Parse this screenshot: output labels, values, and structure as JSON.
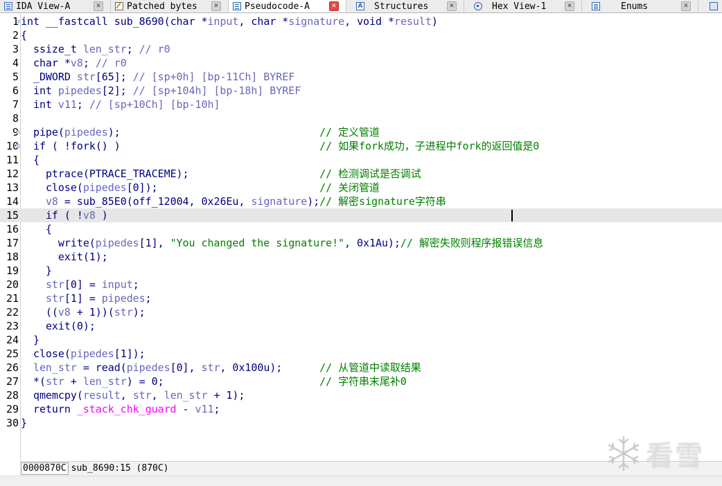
{
  "tabs": [
    {
      "label": "IDA View-A",
      "icon": "ida-view-icon",
      "active": false
    },
    {
      "label": "Patched bytes",
      "icon": "patch-icon",
      "active": false
    },
    {
      "label": "Pseudocode-A",
      "icon": "pseudocode-icon",
      "active": true
    },
    {
      "label": "Structures",
      "icon": "structures-icon",
      "active": false
    },
    {
      "label": "Hex View-1",
      "icon": "hex-view-icon",
      "active": false
    },
    {
      "label": "Enums",
      "icon": "enums-icon",
      "active": false
    },
    {
      "label": "",
      "icon": "imports-icon",
      "active": false
    }
  ],
  "code": {
    "current_line": 15,
    "lines": [
      {
        "n": "1",
        "text": "int __fastcall sub_8690(char *input, char *signature, void *result)"
      },
      {
        "n": "2",
        "text": "{"
      },
      {
        "n": "3",
        "text": "  ssize_t len_str; // r0"
      },
      {
        "n": "4",
        "text": "  char *v8; // r0"
      },
      {
        "n": "5",
        "text": "  _DWORD str[65]; // [sp+0h] [bp-11Ch] BYREF"
      },
      {
        "n": "6",
        "text": "  int pipedes[2]; // [sp+104h] [bp-18h] BYREF"
      },
      {
        "n": "7",
        "text": "  int v11; // [sp+10Ch] [bp-10h]"
      },
      {
        "n": "8",
        "text": ""
      },
      {
        "n": "9",
        "text": "  pipe(pipedes);                                // 定义管道"
      },
      {
        "n": "10",
        "text": "  if ( !fork() )                                // 如果fork成功，子进程中fork的返回值是0"
      },
      {
        "n": "11",
        "text": "  {"
      },
      {
        "n": "12",
        "text": "    ptrace(PTRACE_TRACEME);                     // 检测调试是否调试"
      },
      {
        "n": "13",
        "text": "    close(pipedes[0]);                          // 关闭管道"
      },
      {
        "n": "14",
        "text": "    v8 = sub_85E0(off_12004, 0x26Eu, signature);// 解密signature字符串"
      },
      {
        "n": "15",
        "text": "    if ( !v8 )"
      },
      {
        "n": "16",
        "text": "    {"
      },
      {
        "n": "17",
        "text": "      write(pipedes[1], \"You changed the signature!\", 0x1Au);// 解密失败则程序报错误信息"
      },
      {
        "n": "18",
        "text": "      exit(1);"
      },
      {
        "n": "19",
        "text": "    }"
      },
      {
        "n": "20",
        "text": "    str[0] = input;"
      },
      {
        "n": "21",
        "text": "    str[1] = pipedes;"
      },
      {
        "n": "22",
        "text": "    ((v8 + 1))(str);"
      },
      {
        "n": "23",
        "text": "    exit(0);"
      },
      {
        "n": "24",
        "text": "  }"
      },
      {
        "n": "25",
        "text": "  close(pipedes[1]);"
      },
      {
        "n": "26",
        "text": "  len_str = read(pipedes[0], str, 0x100u);      // 从管道中读取结果"
      },
      {
        "n": "27",
        "text": "  *(str + len_str) = 0;                         // 字符串末尾补0"
      },
      {
        "n": "28",
        "text": "  qmemcpy(result, str, len_str + 1);"
      },
      {
        "n": "29",
        "text": "  return _stack_chk_guard - v11;"
      },
      {
        "n": "30",
        "text": "}"
      }
    ]
  },
  "status": {
    "address": "0000870C",
    "position": "sub_8690:15 (870C)"
  },
  "watermark": {
    "text": "看雪",
    "logo": "snowflake-icon"
  },
  "colors": {
    "keyword": "#000080",
    "variable": "#6767bb",
    "comment": "#008000",
    "import": "#ff00ff",
    "current_line_bg": "#e6e6e6"
  }
}
